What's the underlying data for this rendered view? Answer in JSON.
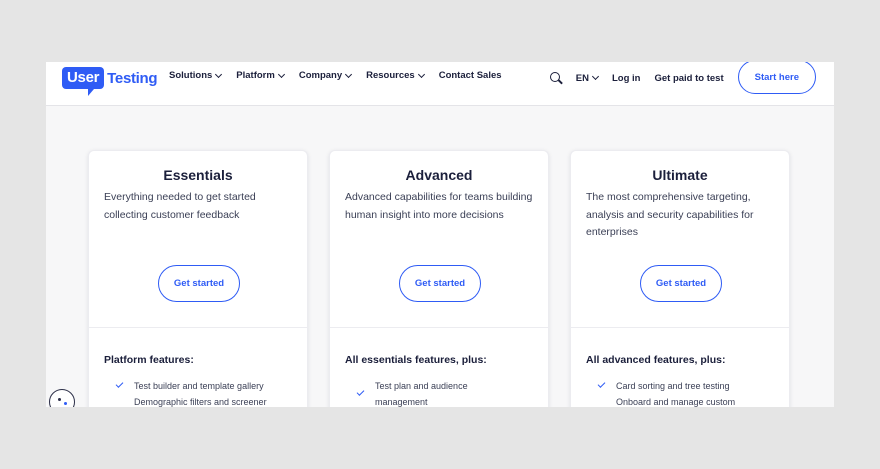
{
  "brand": {
    "logo_part1": "User",
    "logo_part2": "Testing"
  },
  "nav": [
    {
      "label": "Solutions",
      "dropdown": true
    },
    {
      "label": "Platform",
      "dropdown": true
    },
    {
      "label": "Company",
      "dropdown": true
    },
    {
      "label": "Resources",
      "dropdown": true
    },
    {
      "label": "Contact Sales",
      "dropdown": false
    }
  ],
  "right_nav": {
    "language": "EN",
    "login": "Log in",
    "get_paid": "Get paid to test",
    "cta": "Start here"
  },
  "plans": [
    {
      "title": "Essentials",
      "description": "Everything needed to get started collecting customer feedback",
      "button": "Get started",
      "features_title": "Platform features:",
      "features": [
        "Test builder and template gallery",
        "Demographic filters and screener"
      ]
    },
    {
      "title": "Advanced",
      "description": "Advanced capabilities for teams building human insight into more decisions",
      "button": "Get started",
      "features_title": "All essentials features, plus:",
      "features": [
        "Test plan and audience management"
      ]
    },
    {
      "title": "Ultimate",
      "description": "The most comprehensive targeting, analysis and security capabilities for enterprises",
      "button": "Get started",
      "features_title": "All advanced features, plus:",
      "features": [
        "Card sorting and tree testing",
        "Onboard and manage custom"
      ]
    }
  ],
  "colors": {
    "accent": "#2f5cf5",
    "text": "#1b1f3b",
    "background": "#f7f7f8"
  }
}
